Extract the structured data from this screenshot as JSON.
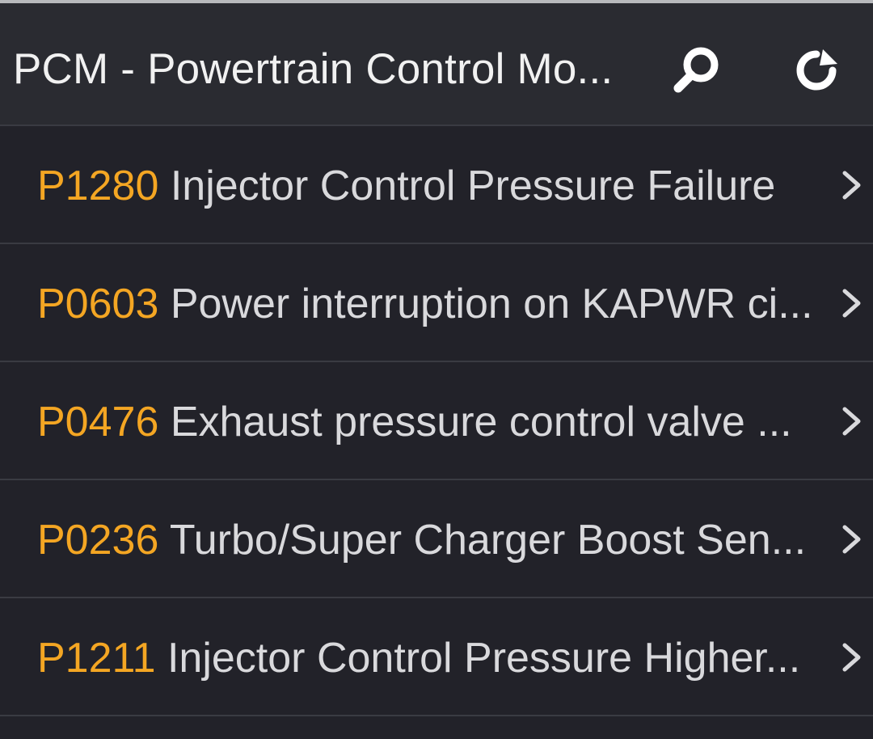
{
  "header": {
    "title": "PCM - Powertrain Control Mo...",
    "search_icon": "search-icon",
    "refresh_icon": "refresh-icon"
  },
  "colors": {
    "code": "#f4a623",
    "description": "#d9d9dc",
    "background": "#222229",
    "header_background": "#2a2b31"
  },
  "dtc_list": [
    {
      "code": "P1280",
      "description": "Injector Control Pressure Failure"
    },
    {
      "code": "P0603",
      "description": "Power interruption on KAPWR ci..."
    },
    {
      "code": "P0476",
      "description": "Exhaust pressure control valve ..."
    },
    {
      "code": "P0236",
      "description": "Turbo/Super Charger Boost Sen..."
    },
    {
      "code": "P1211",
      "description": "Injector Control Pressure Higher..."
    }
  ]
}
